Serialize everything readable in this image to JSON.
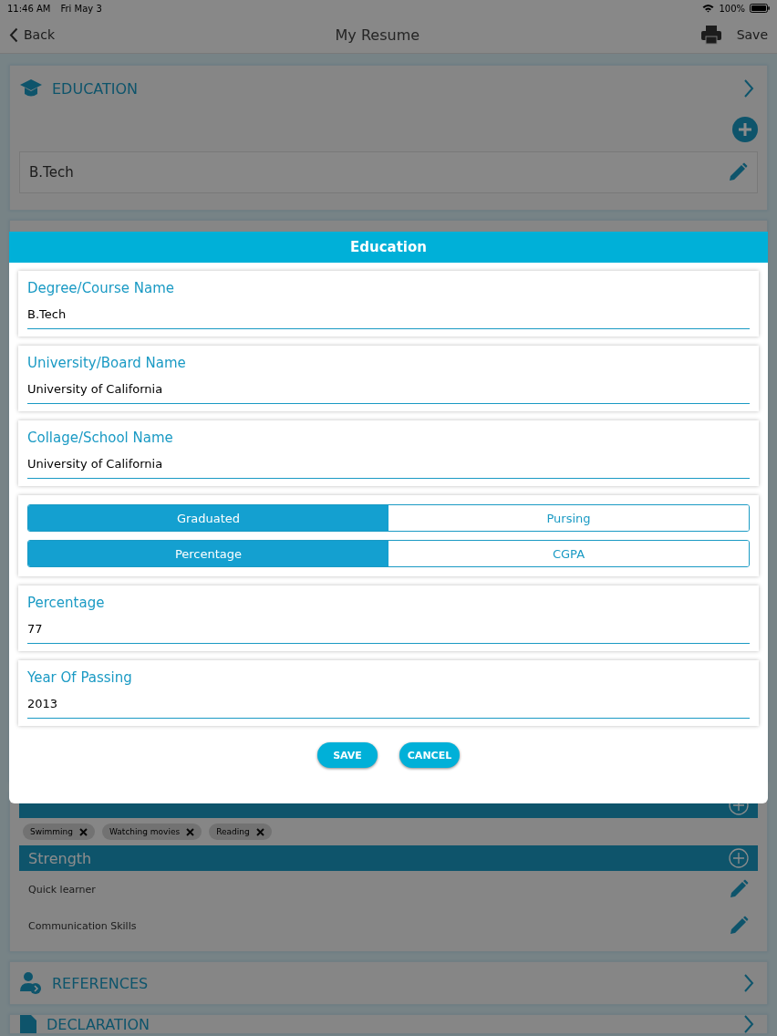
{
  "status_bar": {
    "time": "11:46 AM",
    "date": "Fri May 3",
    "battery": "100%"
  },
  "nav_bar": {
    "back": "Back",
    "title": "My Resume",
    "save": "Save"
  },
  "education": {
    "title": "EDUCATION",
    "items": [
      "B.Tech"
    ]
  },
  "hobby": {
    "chips": [
      "Swimming",
      "Watching movies",
      "Reading"
    ]
  },
  "strength": {
    "title": "Strength",
    "items": [
      "Quick learner",
      "Communication Skills"
    ]
  },
  "references": {
    "title": "REFERENCES"
  },
  "declaration": {
    "title": "DECLARATION"
  },
  "dialog": {
    "title": "Education",
    "rows": [
      {
        "kind": "field",
        "label": "Degree/Course Name",
        "value": "B.Tech"
      },
      {
        "kind": "field",
        "label": "University/Board Name",
        "value": "University of California"
      },
      {
        "kind": "field",
        "label": "Collage/School Name",
        "value": "University of California"
      },
      {
        "kind": "segments",
        "groups": [
          [
            {
              "label": "Graduated",
              "selected": true
            },
            {
              "label": "Pursing",
              "selected": false
            }
          ],
          [
            {
              "label": "Percentage",
              "selected": true
            },
            {
              "label": "CGPA",
              "selected": false
            }
          ]
        ]
      },
      {
        "kind": "field",
        "label": "Percentage",
        "value": "77"
      },
      {
        "kind": "field",
        "label": "Year Of Passing",
        "value": "2013"
      }
    ],
    "buttons": [
      "SAVE",
      "CANCEL"
    ]
  }
}
